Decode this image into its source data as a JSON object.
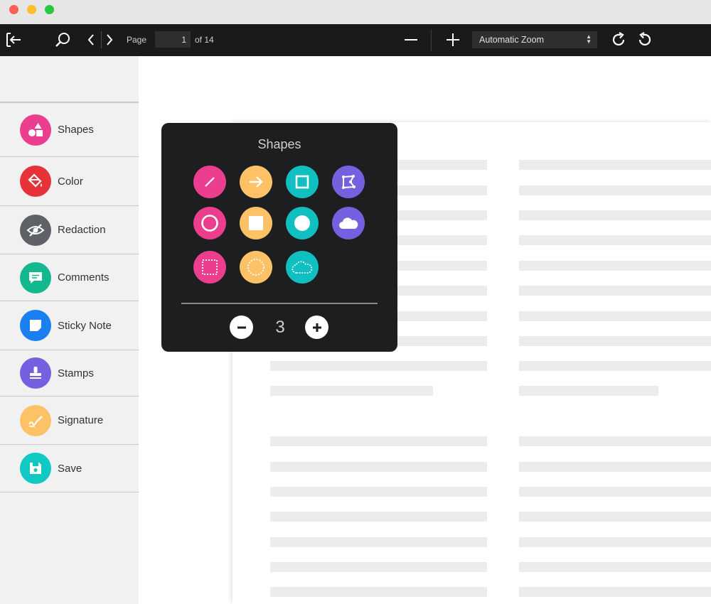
{
  "window": {
    "traffic_lights": [
      "#fe5f57",
      "#febc2e",
      "#28c840"
    ]
  },
  "toolbar": {
    "exit_icon": "exit-icon",
    "search_icon": "search-icon",
    "page_label": "Page",
    "page_value": "1",
    "page_of": "of 14",
    "zoom_value": "Automatic Zoom",
    "zoom_out_icon": "minus-icon",
    "zoom_in_icon": "plus-icon",
    "rotate_cw_icon": "rotate-clockwise-icon",
    "rotate_ccw_icon": "rotate-counterclockwise-icon"
  },
  "sidebar": {
    "items": [
      {
        "label": "Shapes",
        "icon": "shapes-icon",
        "color": "#ec3e8f"
      },
      {
        "label": "Color",
        "icon": "paint-bucket-icon",
        "color": "#e8323a"
      },
      {
        "label": "Redaction",
        "icon": "eye-slash-icon",
        "color": "#5e6266"
      },
      {
        "label": "Comments",
        "icon": "comment-icon",
        "color": "#14b88f"
      },
      {
        "label": "Sticky Note",
        "icon": "sticky-note-icon",
        "color": "#1a7ff0"
      },
      {
        "label": "Stamps",
        "icon": "stamp-icon",
        "color": "#7561e0"
      },
      {
        "label": "Signature",
        "icon": "signature-icon",
        "color": "#fdc266"
      },
      {
        "label": "Save",
        "icon": "save-icon",
        "color": "#10c9c3"
      }
    ]
  },
  "shapes_popup": {
    "title": "Shapes",
    "shapes": [
      {
        "name": "line",
        "color": "#ec3e8f"
      },
      {
        "name": "arrow",
        "color": "#fdc266"
      },
      {
        "name": "rectangle-outline",
        "color": "#10bfc0"
      },
      {
        "name": "polygon",
        "color": "#7561e0"
      },
      {
        "name": "circle-outline",
        "color": "#ec3e8f"
      },
      {
        "name": "rectangle-filled",
        "color": "#fdc266"
      },
      {
        "name": "circle-filled",
        "color": "#10bfc0"
      },
      {
        "name": "cloud-filled",
        "color": "#7561e0"
      },
      {
        "name": "rectangle-dashed",
        "color": "#ec3e8f"
      },
      {
        "name": "circle-dashed",
        "color": "#fdc266"
      },
      {
        "name": "cloud-dashed",
        "color": "#10bfc0"
      }
    ],
    "stroke_width": "3"
  }
}
